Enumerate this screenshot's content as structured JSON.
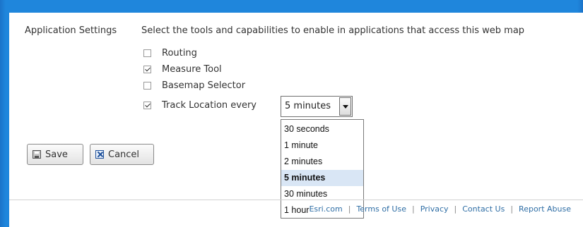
{
  "settings": {
    "section_label": "Application Settings",
    "description": "Select the tools and capabilities to enable in applications that access this web map",
    "options": [
      {
        "label": "Routing",
        "checked": false
      },
      {
        "label": "Measure Tool",
        "checked": true
      },
      {
        "label": "Basemap Selector",
        "checked": false
      },
      {
        "label": "Track Location every",
        "checked": true
      }
    ],
    "track_interval": {
      "selected": "5 minutes",
      "options": [
        "30 seconds",
        "1 minute",
        "2 minutes",
        "5 minutes",
        "30 minutes",
        "1 hour"
      ]
    }
  },
  "buttons": {
    "save_label": "Save",
    "cancel_label": "Cancel"
  },
  "footer": {
    "links": [
      "Esri.com",
      "Terms of Use",
      "Privacy",
      "Contact Us",
      "Report Abuse"
    ]
  },
  "colors": {
    "background": "#1f86dc",
    "link": "#2f6ea5",
    "selected_option": "#d9e6f5"
  },
  "icons": [
    "checkbox-icon",
    "floppy-disk-icon",
    "cancel-x-icon",
    "dropdown-arrow-icon"
  ]
}
